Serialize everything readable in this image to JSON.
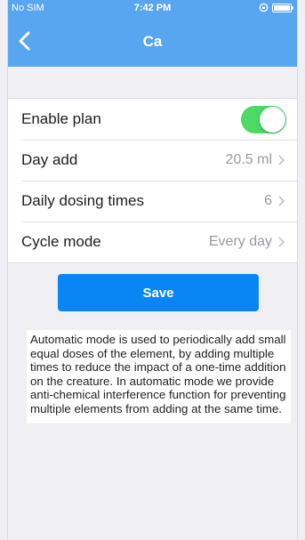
{
  "status_bar": {
    "carrier": "No SIM",
    "time": "7:42 PM"
  },
  "nav": {
    "title": "Ca",
    "back_icon": "chevron-left-icon"
  },
  "settings": {
    "enable_plan": {
      "label": "Enable plan",
      "enabled": true
    },
    "day_add": {
      "label": "Day add",
      "value": "20.5 ml"
    },
    "daily_dosing_times": {
      "label": "Daily dosing times",
      "value": "6"
    },
    "cycle_mode": {
      "label": "Cycle mode",
      "value": "Every day"
    }
  },
  "save_button": {
    "label": "Save"
  },
  "description": "Automatic mode is used to periodically add small equal doses of the element, by adding multiple times to reduce the impact of a one-time addition on the creature. In automatic mode we provide anti-chemical interference function for preventing multiple elements from adding at the same time.",
  "colors": {
    "header": "#58a6ef",
    "toggle_on": "#4cd964",
    "save_button": "#0a86f4"
  }
}
